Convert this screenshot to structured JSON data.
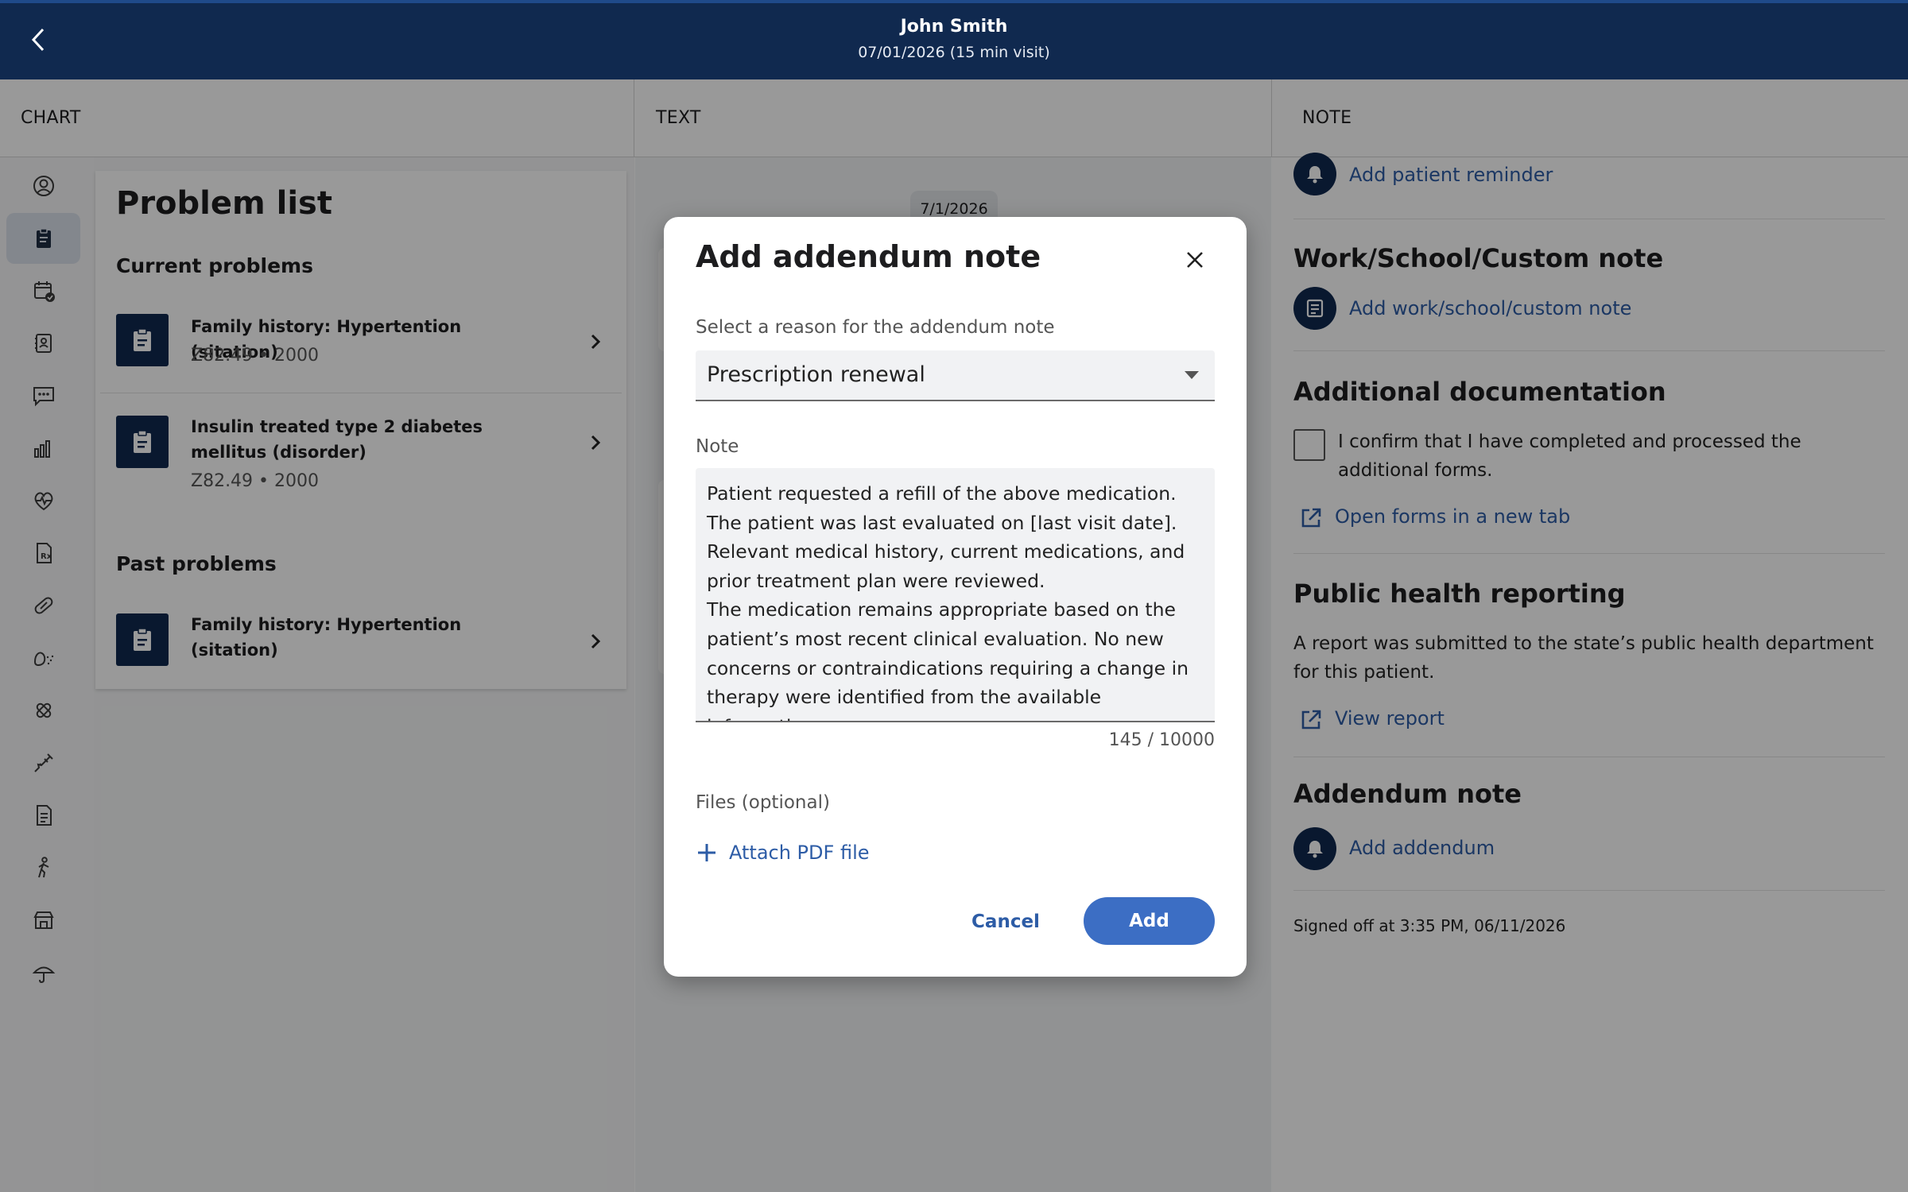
{
  "header": {
    "patient_name": "John Smith",
    "visit_info": "07/01/2026 (15 min visit)"
  },
  "columns": {
    "chart": "CHART",
    "text": "TEXT",
    "note": "NOTE"
  },
  "rail_icons": [
    "person-icon",
    "clipboard-icon",
    "calendar-check-icon",
    "contacts-book-icon",
    "chat-icon",
    "bar-chart-icon",
    "heart-pulse-icon",
    "prescription-icon",
    "pill-icon",
    "lungs-icon",
    "virus-icon",
    "syringe-icon",
    "document-icon",
    "walking-person-icon",
    "store-icon",
    "umbrella-icon"
  ],
  "problem_list": {
    "title": "Problem list",
    "current_heading": "Current problems",
    "past_heading": "Past problems",
    "current": [
      {
        "name": "Family history: Hypertention (sitation)",
        "meta": "Z82.49 • 2000"
      },
      {
        "name": "Insulin treated type 2 diabetes mellitus (disorder)",
        "meta": "Z82.49 • 2000"
      }
    ],
    "past": [
      {
        "name": "Family history: Hypertention (sitation)"
      }
    ]
  },
  "text_panel": {
    "date_chip": "7/1/2026"
  },
  "note_panel": {
    "patient_reminder_link": "Add patient reminder",
    "work_school_heading": "Work/School/Custom note",
    "work_school_link": "Add work/school/custom note",
    "additional_doc_heading": "Additional documentation",
    "confirm_text": "I confirm that I have completed and processed the additional forms.",
    "open_forms_link": "Open forms in a new tab",
    "public_health_heading": "Public health reporting",
    "public_health_text": "A report was submitted to the state’s public health department for this patient.",
    "view_report_link": "View report",
    "addendum_heading": "Addendum note",
    "addendum_link": "Add addendum",
    "signoff": "Signed off at 3:35 PM, 06/11/2026"
  },
  "modal": {
    "title": "Add addendum note",
    "reason_label": "Select a reason for the addendum note",
    "reason_value": "Prescription renewal",
    "note_label": "Note",
    "note_value": "Patient requested a refill of the above medication. The patient was last evaluated on [last visit date]. Relevant medical history, current medications, and prior treatment plan were reviewed.\nThe medication remains appropriate based on the patient’s most recent clinical evaluation. No new concerns or contraindications requiring a change in therapy were identified from the available information.",
    "counter": "145 / 10000",
    "files_label": "Files (optional)",
    "attach_label": "Attach PDF file",
    "cancel_label": "Cancel",
    "add_label": "Add"
  },
  "colors": {
    "header_bg": "#10294f",
    "accent": "#3c6ec4",
    "link": "#2d5ca6"
  }
}
